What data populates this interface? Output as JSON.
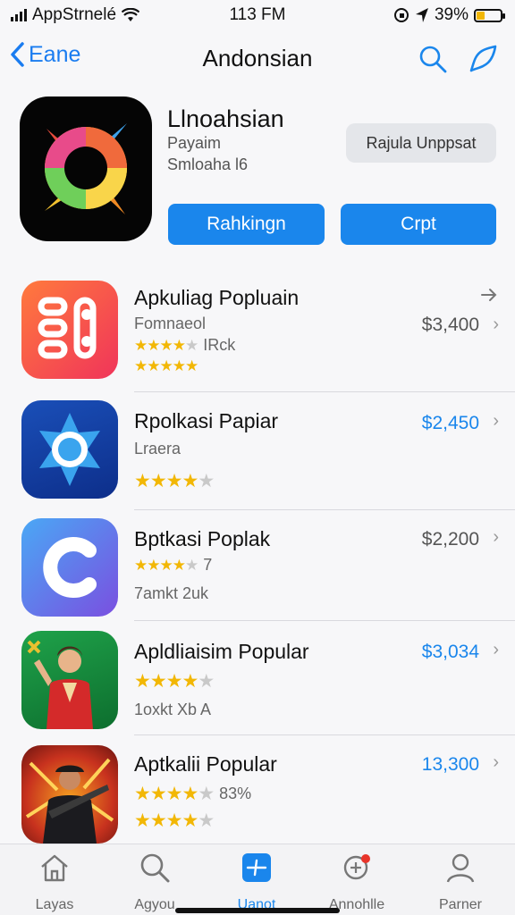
{
  "status_bar": {
    "carrier": "AppStrnelé",
    "time": "113 FM",
    "battery": "39%"
  },
  "nav": {
    "back_label": "Eane",
    "title": "Andonsian"
  },
  "header": {
    "app_name": "Llnoahsian",
    "subtitle": "Payaim",
    "subtitle2": "Smloaha l6",
    "gray_button": "Rajula Unppsat",
    "blue_button_left": "Rahkingn",
    "blue_button_right": "Crpt"
  },
  "apps": [
    {
      "title": "Apkuliag Popluain",
      "line1": "Fomnaeol",
      "line2_stars": 4,
      "line2_text": "IRck",
      "line3_stars": 5,
      "price": "$3,400",
      "price_color": "#555555"
    },
    {
      "title": "Rpolkasi Papiar",
      "line1": "Lraera",
      "line2_stars": 4,
      "line2_text": "",
      "price": "$2,450",
      "price_color": "#1a86ec"
    },
    {
      "title": "Bptkasi Poplak",
      "line1_stars": 4,
      "line1_text": "7",
      "line2": "7amkt 2uk",
      "price": "$2,200",
      "price_color": "#555555"
    },
    {
      "title": "Apldliaisim Popular",
      "line1_stars": 4,
      "line1_text": "",
      "line2": "1oxkt Xb A",
      "price": "$3,034",
      "price_color": "#1a86ec"
    },
    {
      "title": "Aptkalii Popular",
      "line1_stars": 4,
      "line1_text": "83%",
      "line2_stars": 4,
      "price": "13,300",
      "price_color": "#1a86ec"
    }
  ],
  "tabs": [
    {
      "label": "Layas",
      "icon": "home-icon"
    },
    {
      "label": "Agyou",
      "icon": "search-icon"
    },
    {
      "label": "Uanot",
      "icon": "apps-icon"
    },
    {
      "label": "Annohlle",
      "icon": "notifications-icon"
    },
    {
      "label": "Parner",
      "icon": "profile-icon"
    }
  ],
  "colors": {
    "accent": "#1a86ec",
    "star": "#f2b705"
  }
}
